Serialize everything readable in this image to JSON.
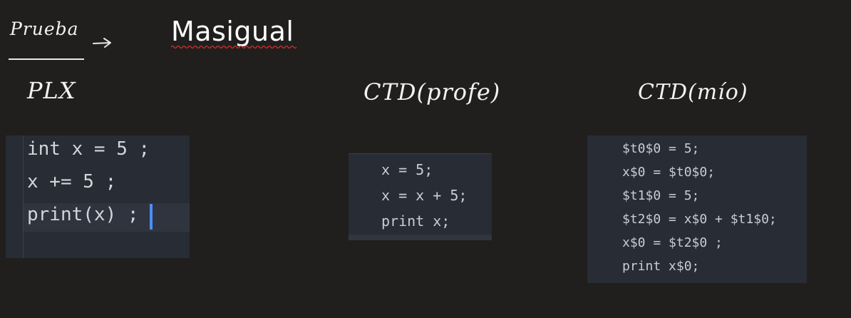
{
  "header": {
    "handwritten_label": "Prueba",
    "title": "Masigual"
  },
  "columns": [
    {
      "label": "PLX",
      "code": [
        "int x = 5 ;",
        "x += 5 ;",
        "print(x) ;"
      ]
    },
    {
      "label": "CTD(profe)",
      "code": [
        "x = 5;",
        "x = x + 5;",
        "print x;"
      ]
    },
    {
      "label": "CTD(mío)",
      "code": [
        "$t0$0 = 5;",
        "x$0 = $t0$0;",
        "$t1$0 = 5;",
        "$t2$0 = x$0 + $t1$0;",
        "x$0 = $t2$0 ;",
        "print x$0;"
      ]
    }
  ],
  "colors": {
    "background": "#201f1e",
    "panel": "#282c34",
    "code_text": "#c8cdd5",
    "cursor": "#4d8ef8",
    "spellcheck_squiggle": "#e03030"
  },
  "icons": [
    "arrow-right-icon",
    "text-cursor-icon"
  ]
}
